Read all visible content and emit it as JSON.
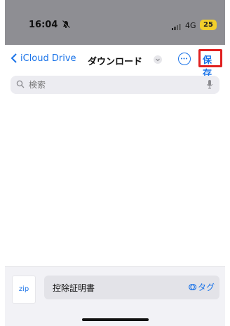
{
  "status_bar": {
    "time": "16:04",
    "network": "4G",
    "battery": "25"
  },
  "nav": {
    "back_label": "iCloud Drive",
    "title": "ダウンロード",
    "save_label": "保存"
  },
  "search": {
    "placeholder": "検索"
  },
  "bottom": {
    "thumb_label": "zip",
    "filename": "控除証明書",
    "tag_label": "タグ"
  },
  "icons": [
    "bell-slash-icon",
    "signal-icon",
    "chevron-left-icon",
    "chevron-down-icon",
    "more-icon",
    "search-icon",
    "mic-icon",
    "tag-icon"
  ],
  "colors": {
    "accent": "#1a73e8",
    "highlight_box": "#e02020",
    "battery": "#f2cf2b"
  }
}
